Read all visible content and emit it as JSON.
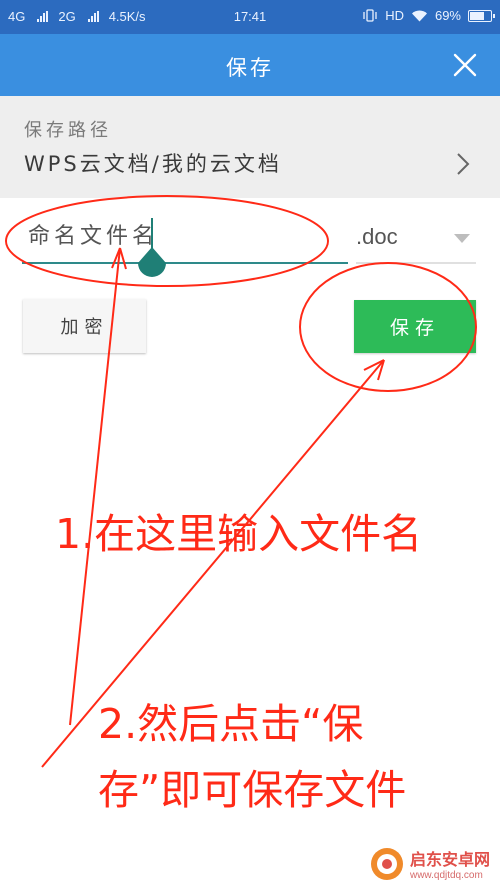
{
  "status_bar": {
    "network1": "4G",
    "network2": "2G",
    "speed": "4.5K/s",
    "time": "17:41",
    "hd": "HD",
    "battery": "69%",
    "battery_level": 0.69
  },
  "dialog": {
    "title": "保存"
  },
  "path": {
    "label": "保存路径",
    "value": "WPS云文档/我的云文档"
  },
  "filename": {
    "placeholder": "命名文件名",
    "value": ""
  },
  "extension": {
    "selected": ".doc"
  },
  "buttons": {
    "encrypt": "加密",
    "save": "保存"
  },
  "annotations": {
    "step1": "1.在这里输入文件名",
    "step2_line1": "2.然后点击“保",
    "step2_line2": "存”即可保存文件",
    "color": "#ff2a17"
  },
  "watermark": {
    "title": "启东安卓网",
    "url": "www.qdjtdq.com"
  },
  "colors": {
    "status_bar": "#2c6bbf",
    "title_bar": "#3a8fe0",
    "save_button": "#2dbb58",
    "cursor": "#1f7f76"
  }
}
